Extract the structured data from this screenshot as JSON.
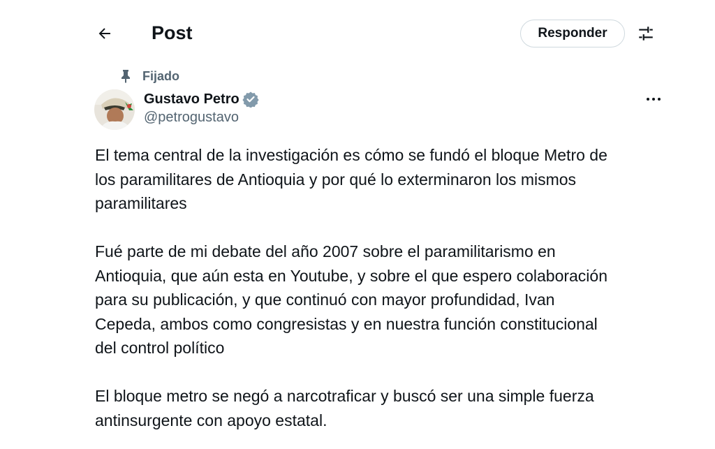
{
  "header": {
    "title": "Post",
    "reply_label": "Responder",
    "back_icon": "back-arrow-icon",
    "settings_icon": "sliders-icon"
  },
  "pinned": {
    "label": "Fijado",
    "icon": "pin-icon"
  },
  "author": {
    "name": "Gustavo Petro",
    "handle": "@petrogustavo",
    "verified_color": "#829aab"
  },
  "post": {
    "paragraphs": [
      "El tema central de la investigación es cómo se fundó el bloque Metro de\nlos paramilitares de Antioquia y por qué lo exterminaron los mismos\nparamilitares",
      "Fué parte de mi debate del año 2007 sobre el paramilitarismo en\nAntioquia, que aún esta en Youtube, y sobre el que espero colaboración\npara su publicación, y que continuó con mayor profundidad, Ivan\nCepeda, ambos como congresistas y en nuestra función constitucional\ndel control político",
      "El bloque metro se negó a narcotraficar y buscó ser una simple fuerza\nantinsurgente con apoyo estatal."
    ]
  },
  "colors": {
    "text_primary": "#0f1419",
    "text_secondary": "#536471",
    "border": "#cfd9de"
  }
}
